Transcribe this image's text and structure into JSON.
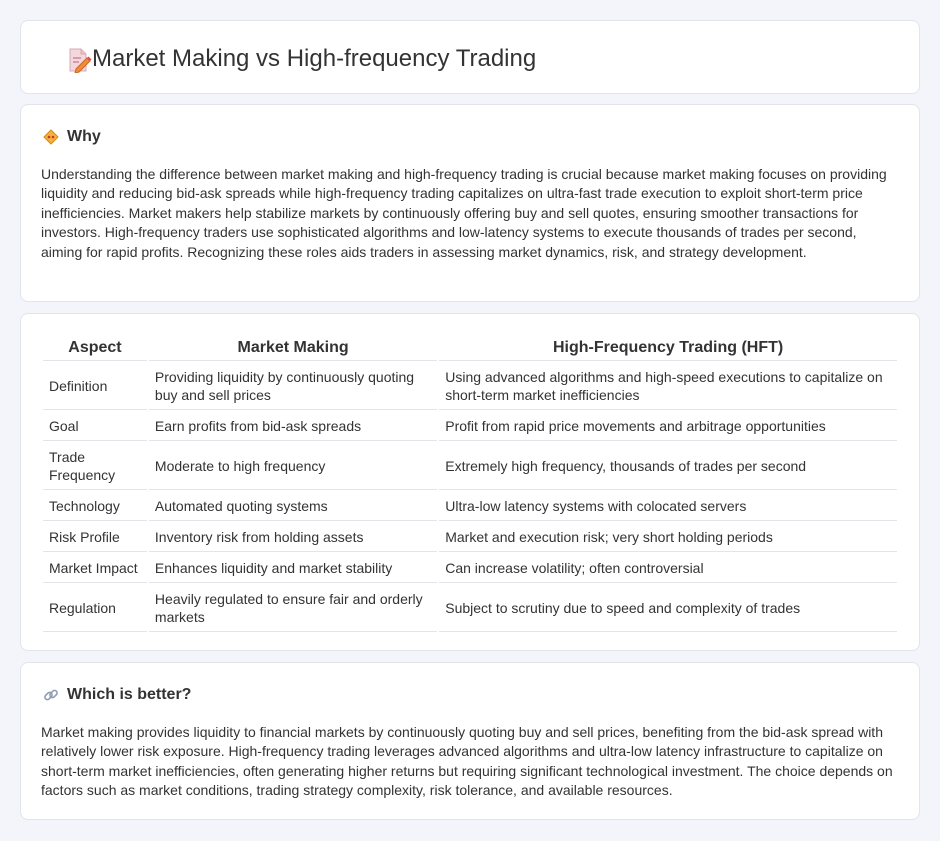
{
  "header": {
    "title": "Market Making vs High-frequency Trading",
    "icon": "document-pencil-icon"
  },
  "why": {
    "title": "Why",
    "icon": "diamond-warning-icon",
    "text": "Understanding the difference between market making and high-frequency trading is crucial because market making focuses on providing liquidity and reducing bid-ask spreads while high-frequency trading capitalizes on ultra-fast trade execution to exploit short-term price inefficiencies. Market makers help stabilize markets by continuously offering buy and sell quotes, ensuring smoother transactions for investors. High-frequency traders use sophisticated algorithms and low-latency systems to execute thousands of trades per second, aiming for rapid profits. Recognizing these roles aids traders in assessing market dynamics, risk, and strategy development."
  },
  "comparison": {
    "headers": [
      "Aspect",
      "Market Making",
      "High-Frequency Trading (HFT)"
    ],
    "rows": [
      [
        "Definition",
        "Providing liquidity by continuously quoting buy and sell prices",
        "Using advanced algorithms and high-speed executions to capitalize on short-term market inefficiencies"
      ],
      [
        "Goal",
        "Earn profits from bid-ask spreads",
        "Profit from rapid price movements and arbitrage opportunities"
      ],
      [
        "Trade Frequency",
        "Moderate to high frequency",
        "Extremely high frequency, thousands of trades per second"
      ],
      [
        "Technology",
        "Automated quoting systems",
        "Ultra-low latency systems with colocated servers"
      ],
      [
        "Risk Profile",
        "Inventory risk from holding assets",
        "Market and execution risk; very short holding periods"
      ],
      [
        "Market Impact",
        "Enhances liquidity and market stability",
        "Can increase volatility; often controversial"
      ],
      [
        "Regulation",
        "Heavily regulated to ensure fair and orderly markets",
        "Subject to scrutiny due to speed and complexity of trades"
      ]
    ]
  },
  "better": {
    "title": "Which is better?",
    "icon": "link-icon",
    "text": "Market making provides liquidity to financial markets by continuously quoting buy and sell prices, benefiting from the bid-ask spread with relatively lower risk exposure. High-frequency trading leverages advanced algorithms and ultra-low latency infrastructure to capitalize on short-term market inefficiencies, often generating higher returns but requiring significant technological investment. The choice depends on factors such as market conditions, trading strategy complexity, risk tolerance, and available resources."
  }
}
